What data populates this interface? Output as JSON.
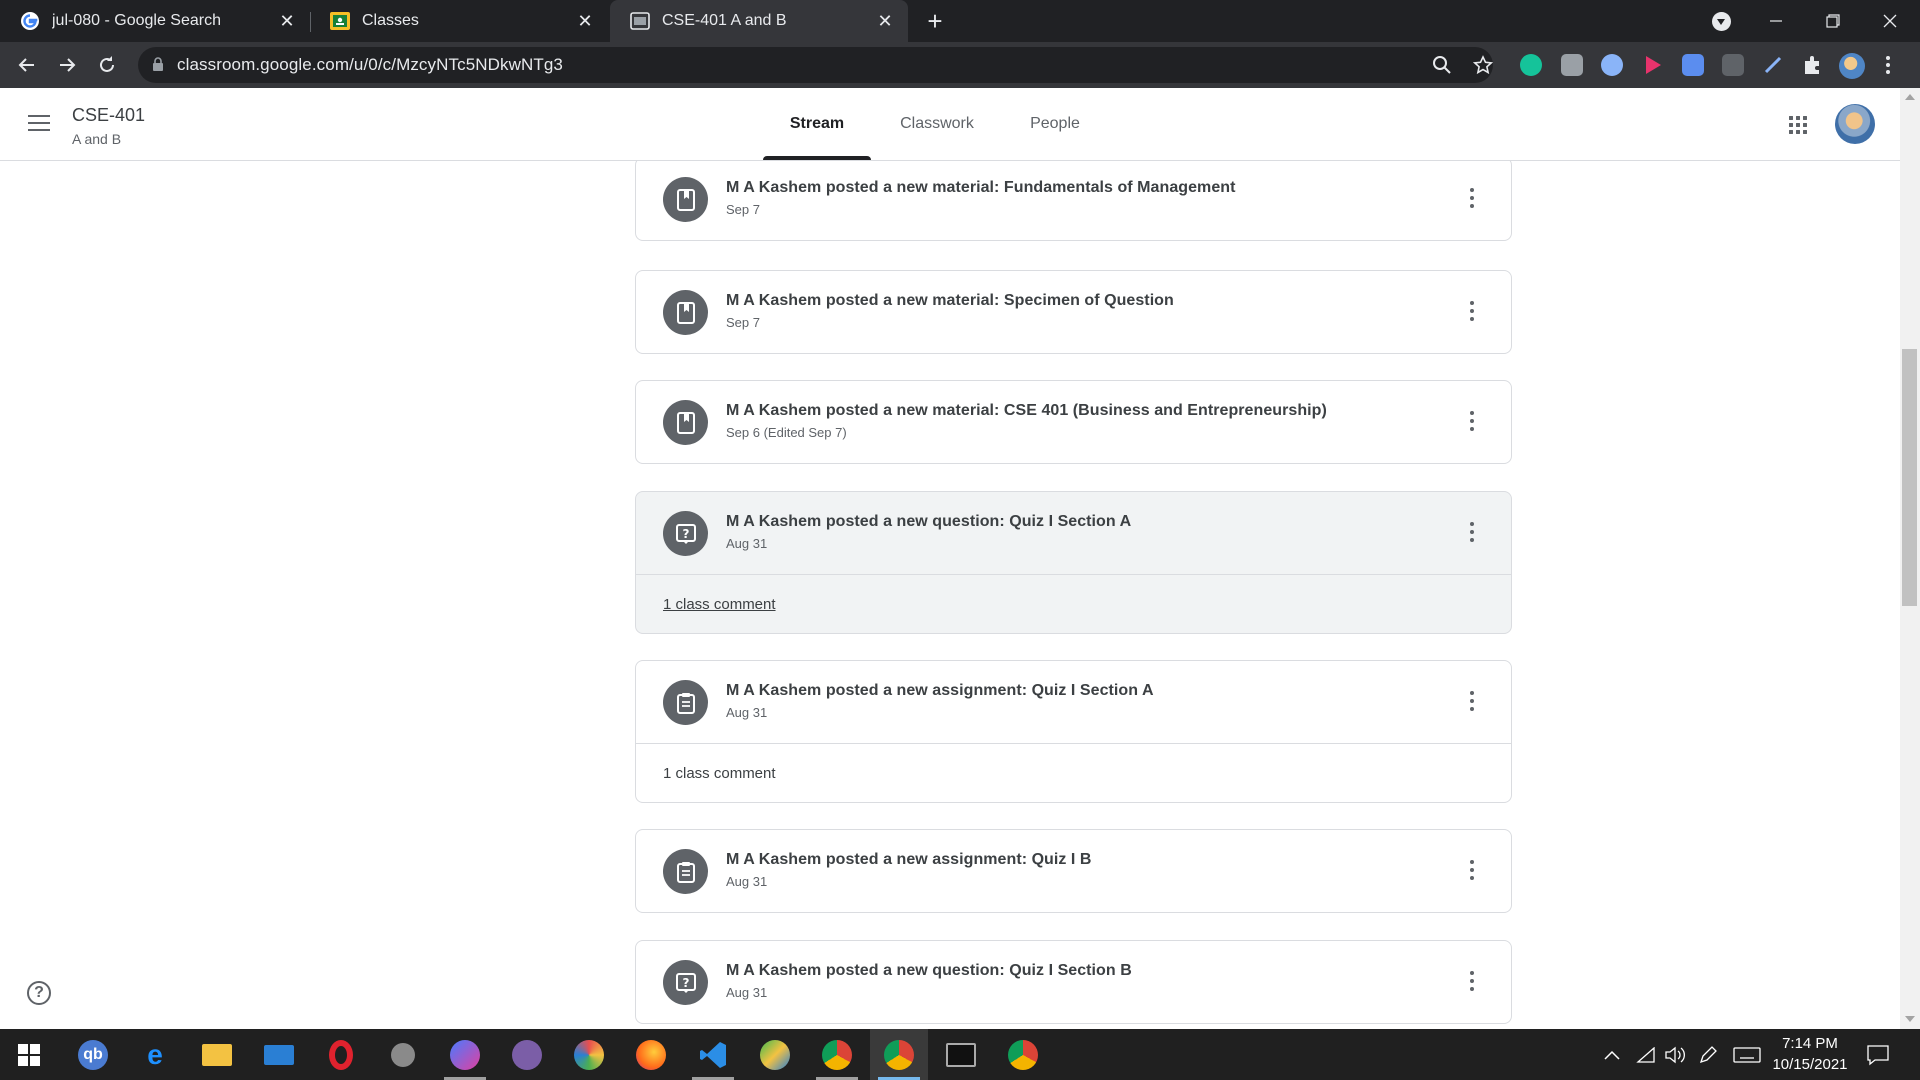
{
  "browser": {
    "tabs": [
      {
        "title": "jul-080 - Google Search",
        "close": "✕"
      },
      {
        "title": "Classes",
        "close": "✕"
      },
      {
        "title": "CSE-401 A and B",
        "close": "✕"
      }
    ],
    "new_tab": "+",
    "url": "classroom.google.com/u/0/c/MzcyNTc5NDkwNTg3"
  },
  "header": {
    "class_name": "CSE-401",
    "class_section": "A and B",
    "tabs": [
      {
        "label": "Stream",
        "active": true
      },
      {
        "label": "Classwork",
        "active": false
      },
      {
        "label": "People",
        "active": false
      }
    ]
  },
  "stream": {
    "posts": [
      {
        "title": "M A Kashem posted a new material: Fundamentals of Management",
        "date": "Sep 7",
        "icon": "material-icon"
      },
      {
        "title": "M A Kashem posted a new material: Specimen of Question",
        "date": "Sep 7",
        "icon": "material-icon"
      },
      {
        "title": "M A Kashem posted a new material: CSE 401 (Business and Entrepreneurship)",
        "date": "Sep 6 (Edited Sep 7)",
        "icon": "material-icon"
      },
      {
        "title": "M A Kashem posted a new question: Quiz I Section A",
        "date": "Aug 31",
        "icon": "question-icon",
        "comment": "1 class comment"
      },
      {
        "title": "M A Kashem posted a new assignment: Quiz I Section A",
        "date": "Aug 31",
        "icon": "assignment-icon",
        "comment": "1 class comment"
      },
      {
        "title": "M A Kashem posted a new assignment: Quiz I B",
        "date": "Aug 31",
        "icon": "assignment-icon"
      },
      {
        "title": "M A Kashem posted a new question: Quiz I Section B",
        "date": "Aug 31",
        "icon": "question-icon"
      }
    ]
  },
  "taskbar": {
    "time": "7:14 PM",
    "date": "10/15/2021"
  },
  "colors": {
    "chrome_dark": "#202124",
    "chrome_toolbar": "#35363a",
    "icon_gray": "#5f6368",
    "text_dark": "#3c4043",
    "border": "#dadce0",
    "hover_card": "#f1f3f4"
  }
}
